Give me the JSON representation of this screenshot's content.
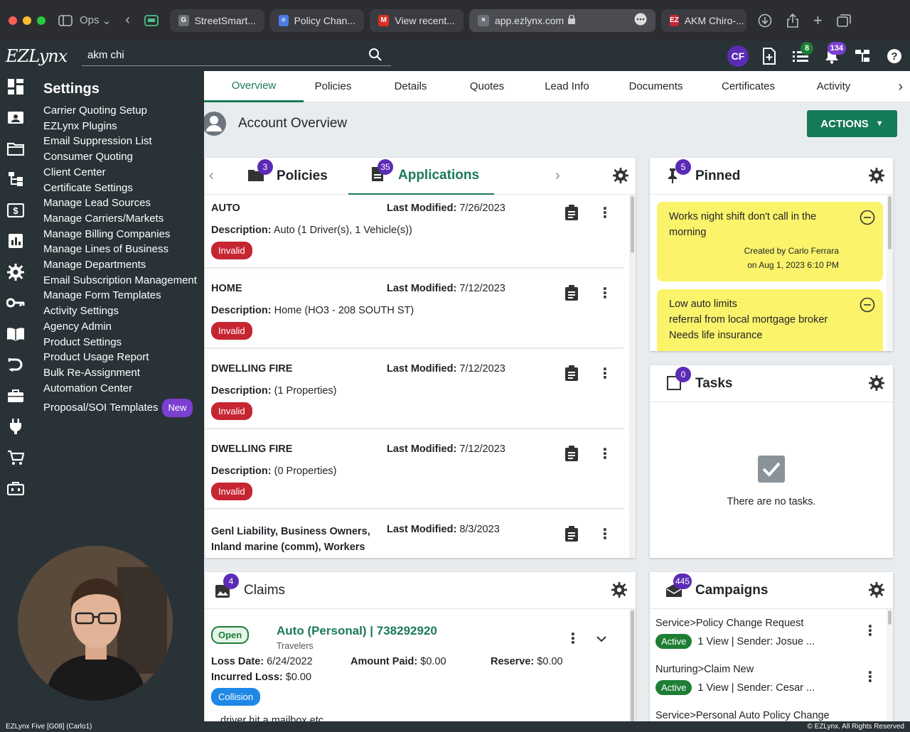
{
  "browser": {
    "tabs": [
      {
        "label": "StreetSmart...",
        "fav_color": "#6c6f75",
        "fav_letter": "G"
      },
      {
        "label": "Policy Chan...",
        "fav_color": "#4b7be5",
        "fav_letter": "≡"
      },
      {
        "label": "View recent...",
        "fav_color": "#d93025",
        "fav_letter": "M"
      },
      {
        "label": "app.ezlynx.com",
        "fav_color": "#6c6f75",
        "fav_letter": "×",
        "active": true
      },
      {
        "label": "AKM Chiro-...",
        "fav_color": "#c62532",
        "fav_letter": "EZ"
      }
    ],
    "workspace": "Ops"
  },
  "header": {
    "logo": "EZLynx",
    "search_value": "akm chi",
    "avatar": "CF",
    "badges": {
      "tasks": "8",
      "notifications": "134"
    },
    "colors": {
      "tasks_badge": "#1e7e34",
      "notif_badge": "#7b3fd1"
    }
  },
  "settings": {
    "title": "Settings",
    "items": [
      "Carrier Quoting Setup",
      "EZLynx Plugins",
      "Email Suppression List",
      "Consumer Quoting",
      "Client Center",
      "Certificate Settings",
      "Manage Lead Sources",
      "Manage Carriers/Markets",
      "Manage Billing Companies",
      "Manage Lines of Business",
      "Manage Departments",
      "Email Subscription Management",
      "Manage Form Templates",
      "Activity Settings",
      "Agency Admin",
      "Product Settings",
      "Product Usage Report",
      "Bulk Re-Assignment",
      "Automation Center"
    ],
    "last_item": "Proposal/SOI Templates",
    "last_item_badge": "New"
  },
  "tabs": [
    "Overview",
    "Policies",
    "Details",
    "Quotes",
    "Lead Info",
    "Documents",
    "Certificates",
    "Activity"
  ],
  "account": {
    "title": "Account Overview",
    "actions": "ACTIONS"
  },
  "policies_card": {
    "policies_tab": "Policies",
    "policies_count": "3",
    "applications_tab": "Applications",
    "applications_count": "35",
    "items": [
      {
        "type": "AUTO",
        "lm_label": "Last Modified:",
        "lm": "7/26/2023",
        "desc_label": "Description:",
        "desc": "Auto (1 Driver(s), 1 Vehicle(s))",
        "status": "Invalid"
      },
      {
        "type": "HOME",
        "lm_label": "Last Modified:",
        "lm": "7/12/2023",
        "desc_label": "Description:",
        "desc": "Home (HO3 - 208 SOUTH ST)",
        "status": "Invalid"
      },
      {
        "type": "DWELLING FIRE",
        "lm_label": "Last Modified:",
        "lm": "7/12/2023",
        "desc_label": "Description:",
        "desc": "(1 Properties)",
        "status": "Invalid"
      },
      {
        "type": "DWELLING FIRE",
        "lm_label": "Last Modified:",
        "lm": "7/12/2023",
        "desc_label": "Description:",
        "desc": "(0 Properties)",
        "status": "Invalid"
      }
    ],
    "last_item_type_1": "Genl Liability, Business Owners,",
    "last_item_type_2": "Inland marine (comm), Workers",
    "last_item_lm_label": "Last Modified:",
    "last_item_lm": "8/3/2023"
  },
  "pinned": {
    "title": "Pinned",
    "count": "5",
    "notes": [
      {
        "text": "Works night shift don't call in the morning",
        "meta1": "Created by Carlo Ferrara",
        "meta2": "on Aug 1, 2023 6:10 PM"
      },
      {
        "line1": "Low auto limits",
        "line2": "referral from local mortgage broker",
        "line3": "Needs life insurance"
      }
    ]
  },
  "tasks": {
    "title": "Tasks",
    "count": "0",
    "empty": "There are no tasks."
  },
  "claims": {
    "title": "Claims",
    "count": "4",
    "status": "Open",
    "claim_title": "Auto (Personal) | 738292920",
    "carrier": "Travelers",
    "loss_date_label": "Loss Date:",
    "loss_date": "6/24/2022",
    "amount_paid_label": "Amount Paid:",
    "amount_paid": "$0.00",
    "reserve_label": "Reserve:",
    "reserve": "$0.00",
    "incurred_label": "Incurred Loss:",
    "incurred": "$0.00",
    "tag": "Collision",
    "note_partial": "driver hit a mailbox etc"
  },
  "campaigns": {
    "title": "Campaigns",
    "count": "445",
    "items": [
      {
        "name": "Service>Policy Change Request",
        "status": "Active",
        "meta": "1 View | Sender: Josue ..."
      },
      {
        "name": "Nurturing>Claim New",
        "status": "Active",
        "meta": "1 View | Sender: Cesar ..."
      },
      {
        "name": "Service>Personal Auto Policy Change"
      }
    ]
  },
  "footer": {
    "left": "EZLynx Five [G08] (Carlo1)",
    "right": "© EZLynx. All Rights Reserved"
  }
}
